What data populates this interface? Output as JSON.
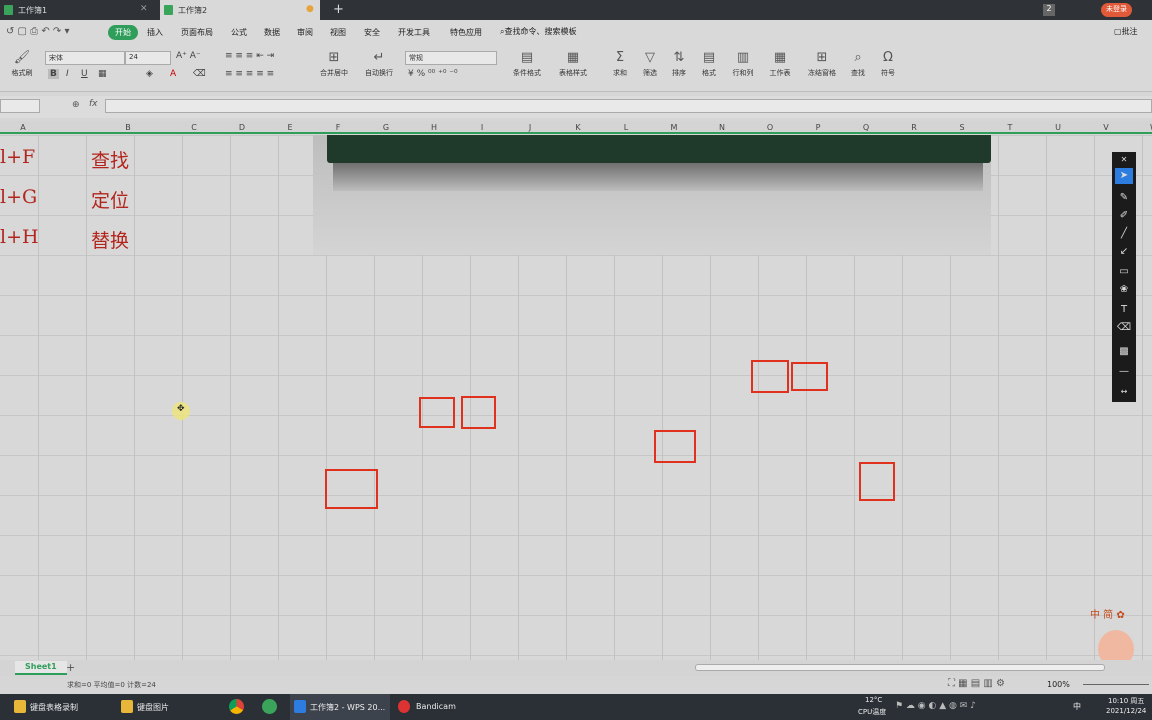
{
  "window_tabs": [
    {
      "label": "工作簿1"
    },
    {
      "label": "工作簿2"
    }
  ],
  "top_right": {
    "page_num": "2",
    "user": "未登录"
  },
  "menu": {
    "items": [
      "开始",
      "插入",
      "页面布局",
      "公式",
      "数据",
      "审阅",
      "视图",
      "安全",
      "开发工具",
      "特色应用"
    ],
    "active": "开始",
    "search": "查找命令、搜索模板",
    "annotate": "批注"
  },
  "ribbon": {
    "format_painter": "格式刷",
    "font_name": "宋体",
    "font_size": "24",
    "number_format": "常规",
    "merge": "合并居中",
    "wrap": "自动换行",
    "cond": "条件格式",
    "table_style": "表格样式",
    "sum": "求和",
    "filter": "筛选",
    "sort": "排序",
    "format": "格式",
    "rowcol": "行和列",
    "sheet": "工作表",
    "freeze": "冻结窗格",
    "find": "查找",
    "symbol": "符号"
  },
  "formula_bar": {
    "fx": "fx"
  },
  "columns": [
    "A",
    "B",
    "C",
    "D",
    "E",
    "F",
    "G",
    "H",
    "I",
    "J",
    "K",
    "L",
    "M",
    "N",
    "O",
    "P",
    "Q",
    "R",
    "S",
    "T",
    "U",
    "V",
    "W"
  ],
  "cells": [
    {
      "key": "l+F",
      "val": "查找"
    },
    {
      "key": "l+G",
      "val": "定位"
    },
    {
      "key": "l+H",
      "val": "替换"
    }
  ],
  "sheet": {
    "name": "Sheet1",
    "add": "+"
  },
  "status": {
    "summary": "求和=0  平均值=0  计数=24",
    "zoom": "100%"
  },
  "taskbar": {
    "items": [
      "键盘表格录制",
      "键盘图片",
      "工作簿2 - WPS 20...",
      "Bandicam"
    ],
    "temp": "12°C",
    "cpu": "CPU温度",
    "time": "10:10 周五",
    "date": "2021/12/24",
    "ime": "中"
  },
  "colors": {
    "accent": "#2f9e5b",
    "annotation": "#e0301e"
  }
}
